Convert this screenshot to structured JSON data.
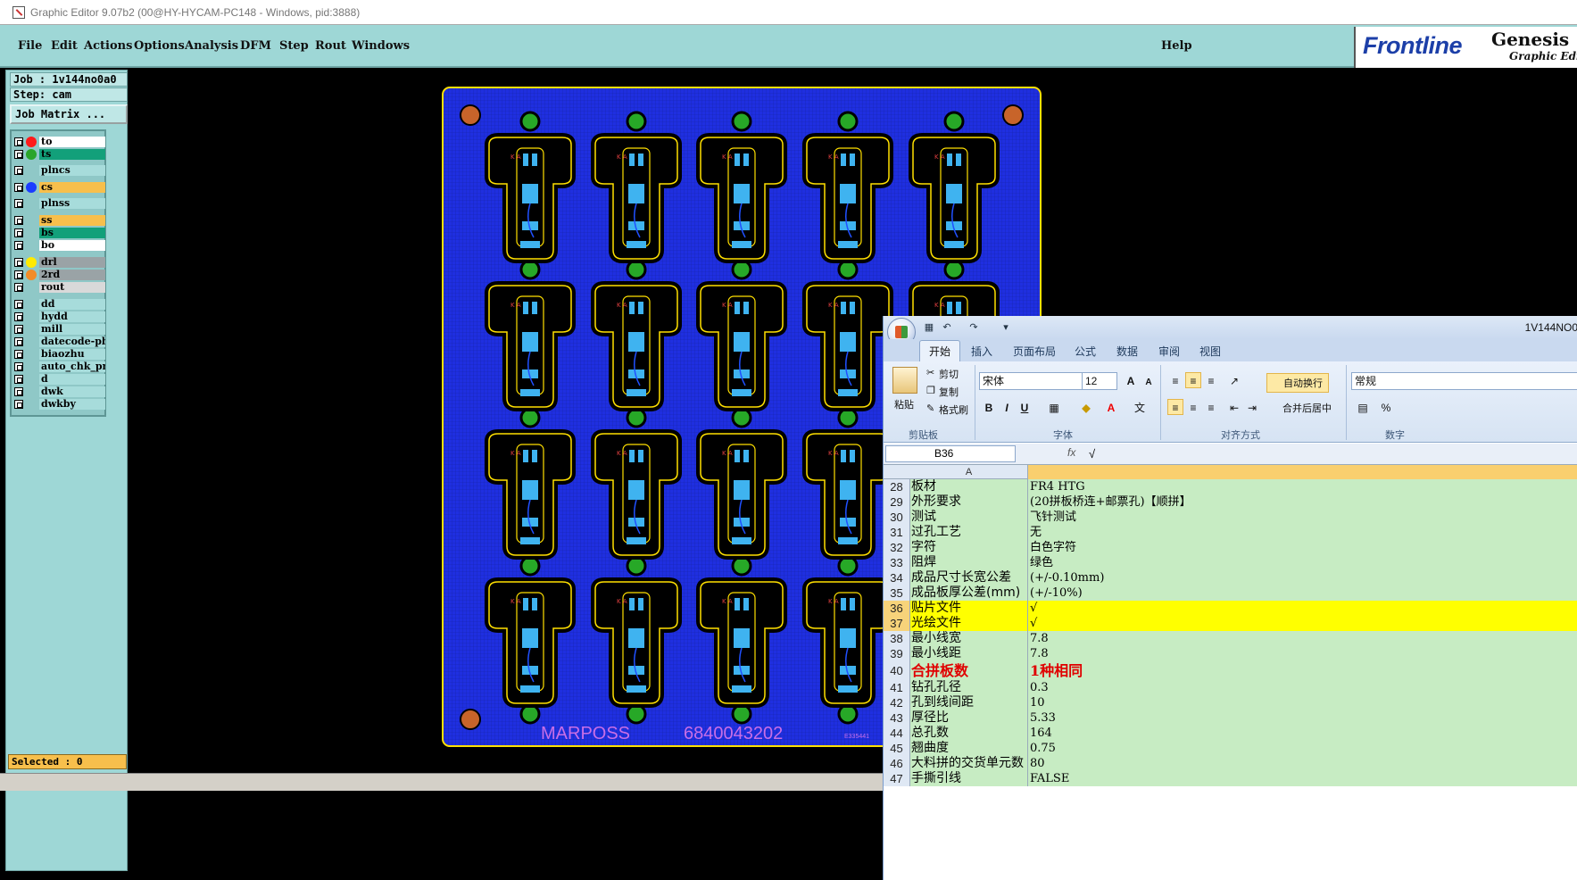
{
  "window": {
    "title": "Graphic Editor 9.07b2 (00@HY-HYCAM-PC148 - Windows, pid:3888)"
  },
  "menu": [
    "File",
    "Edit",
    "Actions",
    "Options",
    "Analysis",
    "DFM",
    "Step",
    "Rout",
    "Windows"
  ],
  "help": "Help",
  "logo": {
    "brand": "Frontline",
    "product": "Genesis",
    "sub": "Graphic Editor"
  },
  "job": {
    "job_line": "Job : 1v144no0a0",
    "step_line": "Step: cam",
    "matrix_button": "Job Matrix ..."
  },
  "layers": [
    {
      "name": "to",
      "color": "#ffffff",
      "dot": "#ff1a1a"
    },
    {
      "name": "ts",
      "color": "#12a07a",
      "dot": "#2aa52a"
    },
    {
      "name": "plncs",
      "color": "#a7dcdb",
      "dot": ""
    },
    {
      "name": "cs",
      "color": "#f7bf4c",
      "dot": "#1a3cff"
    },
    {
      "name": "plnss",
      "color": "#a7dcdb",
      "dot": ""
    },
    {
      "name": "ss",
      "color": "#f7bf4c",
      "dot": ""
    },
    {
      "name": "bs",
      "color": "#12a07a",
      "dot": ""
    },
    {
      "name": "bo",
      "color": "#ffffff",
      "dot": ""
    },
    {
      "name": "drl",
      "color": "#9aa3a6",
      "dot": "#ffea00"
    },
    {
      "name": "2rd",
      "color": "#9aa3a6",
      "dot": "#f28c28"
    },
    {
      "name": "rout",
      "color": "#d9d9d9",
      "dot": ""
    },
    {
      "name": "dd",
      "color": "#a7dcdb",
      "dot": ""
    },
    {
      "name": "hydd",
      "color": "#a7dcdb",
      "dot": ""
    },
    {
      "name": "mill",
      "color": "#a7dcdb",
      "dot": ""
    },
    {
      "name": "datecode-pbe",
      "color": "#a7dcdb",
      "dot": ""
    },
    {
      "name": "biaozhu",
      "color": "#a7dcdb",
      "dot": ""
    },
    {
      "name": "auto_chk_pn.",
      "color": "#a7dcdb",
      "dot": ""
    },
    {
      "name": "d",
      "color": "#a7dcdb",
      "dot": ""
    },
    {
      "name": "dwk",
      "color": "#a7dcdb",
      "dot": ""
    },
    {
      "name": "dwkby",
      "color": "#a7dcdb",
      "dot": ""
    }
  ],
  "selected": "Selected : 0",
  "pcb": {
    "text_left": "MARPOSS",
    "text_right": "6840043202",
    "small": "E335441",
    "unit_label": "K A",
    "colors": {
      "board": "#1f2fe0",
      "outline": "#ffe000",
      "unit_bg": "#000000",
      "pad": "#3fb3f0",
      "via": "#27a827",
      "fiducial": "#c8642a",
      "marking": "#c86ee6"
    }
  },
  "excel": {
    "filename": "1V144NO0",
    "tabs": [
      "开始",
      "插入",
      "页面布局",
      "公式",
      "数据",
      "审阅",
      "视图"
    ],
    "clipboard": {
      "paste": "粘贴",
      "cut": "剪切",
      "copy": "复制",
      "format": "格式刷",
      "group": "剪贴板"
    },
    "font": {
      "name": "宋体",
      "size": "12",
      "group": "字体"
    },
    "align": {
      "wrap": "自动换行",
      "merge": "合并后居中",
      "group": "对齐方式"
    },
    "number": {
      "format": "常规",
      "group": "数字",
      "pct": "%"
    },
    "namebox": "B36",
    "fx": "fx",
    "formula": "√",
    "col_a": "A",
    "rows": [
      {
        "n": "28",
        "a": "板材",
        "b": "FR4 HTG"
      },
      {
        "n": "29",
        "a": "外形要求",
        "b": "(20拼板桥连+邮票孔)【顺拼】"
      },
      {
        "n": "30",
        "a": "测试",
        "b": "飞针测试"
      },
      {
        "n": "31",
        "a": "过孔工艺",
        "b": "无"
      },
      {
        "n": "32",
        "a": "字符",
        "b": "白色字符"
      },
      {
        "n": "33",
        "a": "阻焊",
        "b": "绿色"
      },
      {
        "n": "34",
        "a": "成品尺寸长宽公差",
        "b": "(+/-0.10mm)"
      },
      {
        "n": "35",
        "a": "成品板厚公差(mm)",
        "b": "(+/-10%)"
      },
      {
        "n": "36",
        "a": "贴片文件",
        "b": "√",
        "hl": true
      },
      {
        "n": "37",
        "a": "光绘文件",
        "b": "√",
        "hl": true
      },
      {
        "n": "38",
        "a": "最小线宽",
        "b": "7.8"
      },
      {
        "n": "39",
        "a": "最小线距",
        "b": "7.8"
      },
      {
        "n": "40",
        "a": "合拼板数",
        "b": "1种相同",
        "big": true
      },
      {
        "n": "41",
        "a": "钻孔孔径",
        "b": "0.3"
      },
      {
        "n": "42",
        "a": "孔到线间距",
        "b": "10"
      },
      {
        "n": "43",
        "a": "厚径比",
        "b": "5.33"
      },
      {
        "n": "44",
        "a": "总孔数",
        "b": "164"
      },
      {
        "n": "45",
        "a": "翘曲度",
        "b": "0.75"
      },
      {
        "n": "46",
        "a": "大料拼的交货单元数",
        "b": "80"
      },
      {
        "n": "47",
        "a": "手撕引线",
        "b": "FALSE"
      }
    ]
  }
}
